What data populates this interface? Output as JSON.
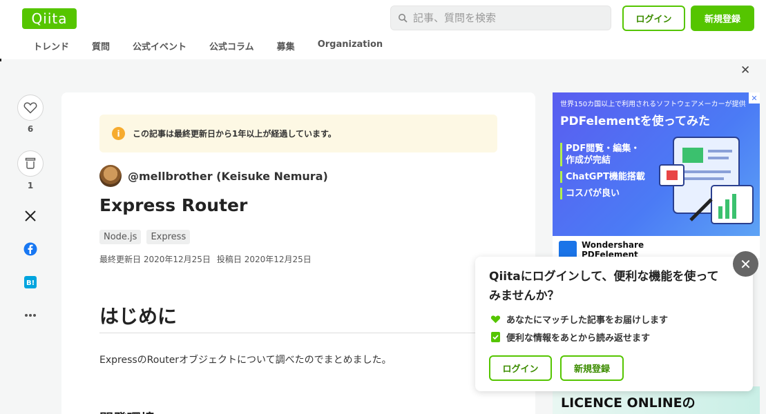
{
  "header": {
    "logo": "Qiita",
    "search_placeholder": "記事、質問を検索",
    "login": "ログイン",
    "signup": "新規登録",
    "nav": [
      "トレンド",
      "質問",
      "公式イベント",
      "公式コラム",
      "募集",
      "Organization"
    ]
  },
  "rail": {
    "like_count": "6",
    "stock_count": "1"
  },
  "article": {
    "notice": "この記事は最終更新日から1年以上が経過しています。",
    "author": "@mellbrother (Keisuke Nemura)",
    "title": "Express Router",
    "tags": [
      "Node.js",
      "Express"
    ],
    "updated": "最終更新日 2020年12月25日",
    "posted": "投稿日 2020年12月25日",
    "heading": "はじめに",
    "paragraph": "ExpressのRouterオブジェクトについて調べたのでまとめました。",
    "next_heading_cut": "開発環境"
  },
  "ad": {
    "top": "世界150カ国以上で利用されるソフトウェアメーカーが提供",
    "headline": "PDFelementを使ってみた",
    "items": [
      "PDF閲覧・編集・",
      "作成が完結",
      "ChatGPT機能搭載",
      "コスパが良い"
    ],
    "brand_line1": "Wondershare",
    "brand_line2": "PDFelement",
    "second": "LICENCE ONLINEの"
  },
  "popup": {
    "title": "Qiitaにログインして、便利な機能を使ってみませんか？",
    "line1": "あなたにマッチした記事をお届けします",
    "line2": "便利な情報をあとから読み返せます",
    "login": "ログイン",
    "signup": "新規登録"
  },
  "colors": {
    "brand": "#55c500",
    "login_text": "#3c8c00"
  }
}
